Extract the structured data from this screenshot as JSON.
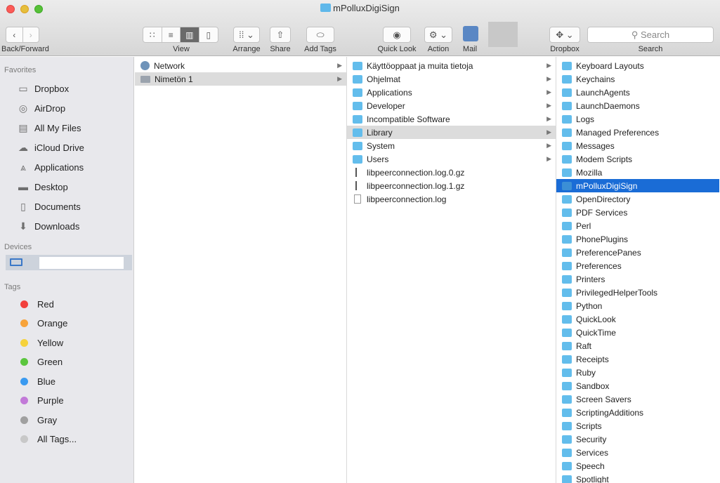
{
  "window": {
    "title": "mPolluxDigiSign"
  },
  "toolbar": {
    "back_forward_label": "Back/Forward",
    "view_label": "View",
    "arrange_label": "Arrange",
    "share_label": "Share",
    "add_tags_label": "Add Tags",
    "quick_look_label": "Quick Look",
    "action_label": "Action",
    "mail_label": "Mail",
    "dropbox_label": "Dropbox",
    "search_label": "Search",
    "search_placeholder": "Search"
  },
  "sidebar": {
    "favorites_header": "Favorites",
    "favorites": [
      {
        "label": "Dropbox",
        "icon": "folder-icon"
      },
      {
        "label": "AirDrop",
        "icon": "airdrop-icon"
      },
      {
        "label": "All My Files",
        "icon": "all-files-icon"
      },
      {
        "label": "iCloud Drive",
        "icon": "cloud-icon"
      },
      {
        "label": "Applications",
        "icon": "applications-icon"
      },
      {
        "label": "Desktop",
        "icon": "desktop-icon"
      },
      {
        "label": "Documents",
        "icon": "documents-icon"
      },
      {
        "label": "Downloads",
        "icon": "downloads-icon"
      }
    ],
    "devices_header": "Devices",
    "tags_header": "Tags",
    "tags": [
      {
        "label": "Red",
        "color": "#f2403c"
      },
      {
        "label": "Orange",
        "color": "#f7a33a"
      },
      {
        "label": "Yellow",
        "color": "#f6d23c"
      },
      {
        "label": "Green",
        "color": "#5bc63e"
      },
      {
        "label": "Blue",
        "color": "#3a9af0"
      },
      {
        "label": "Purple",
        "color": "#c27ad8"
      },
      {
        "label": "Gray",
        "color": "#a0a0a0"
      },
      {
        "label": "All Tags...",
        "color": "#c8c8c8"
      }
    ]
  },
  "columns": {
    "col1": [
      {
        "label": "Network",
        "icon": "globe",
        "arrow": true,
        "state": ""
      },
      {
        "label": "Nimetön 1",
        "icon": "disk",
        "arrow": true,
        "state": "sel-gray"
      }
    ],
    "col2": [
      {
        "label": "Käyttöoppaat ja muita tietoja",
        "icon": "folder",
        "arrow": true,
        "state": ""
      },
      {
        "label": "Ohjelmat",
        "icon": "folder",
        "arrow": true,
        "state": ""
      },
      {
        "label": "Applications",
        "icon": "folder",
        "arrow": true,
        "state": ""
      },
      {
        "label": "Developer",
        "icon": "folder",
        "arrow": true,
        "state": ""
      },
      {
        "label": "Incompatible Software",
        "icon": "folder",
        "arrow": true,
        "state": ""
      },
      {
        "label": "Library",
        "icon": "folder",
        "arrow": true,
        "state": "sel-gray"
      },
      {
        "label": "System",
        "icon": "folder",
        "arrow": true,
        "state": ""
      },
      {
        "label": "Users",
        "icon": "folder",
        "arrow": true,
        "state": ""
      },
      {
        "label": "libpeerconnection.log.0.gz",
        "icon": "gz",
        "arrow": false,
        "state": ""
      },
      {
        "label": "libpeerconnection.log.1.gz",
        "icon": "gz",
        "arrow": false,
        "state": ""
      },
      {
        "label": "libpeerconnection.log",
        "icon": "doc",
        "arrow": false,
        "state": ""
      }
    ],
    "col3": [
      {
        "label": "Keyboard Layouts",
        "icon": "folder",
        "arrow": false,
        "state": ""
      },
      {
        "label": "Keychains",
        "icon": "folder",
        "arrow": false,
        "state": ""
      },
      {
        "label": "LaunchAgents",
        "icon": "folder",
        "arrow": false,
        "state": ""
      },
      {
        "label": "LaunchDaemons",
        "icon": "folder",
        "arrow": false,
        "state": ""
      },
      {
        "label": "Logs",
        "icon": "folder",
        "arrow": false,
        "state": ""
      },
      {
        "label": "Managed Preferences",
        "icon": "folder",
        "arrow": false,
        "state": ""
      },
      {
        "label": "Messages",
        "icon": "folder",
        "arrow": false,
        "state": ""
      },
      {
        "label": "Modem Scripts",
        "icon": "folder",
        "arrow": false,
        "state": ""
      },
      {
        "label": "Mozilla",
        "icon": "folder",
        "arrow": false,
        "state": ""
      },
      {
        "label": "mPolluxDigiSign",
        "icon": "folder",
        "arrow": false,
        "state": "sel-blue"
      },
      {
        "label": "OpenDirectory",
        "icon": "folder",
        "arrow": false,
        "state": ""
      },
      {
        "label": "PDF Services",
        "icon": "folder",
        "arrow": false,
        "state": ""
      },
      {
        "label": "Perl",
        "icon": "folder",
        "arrow": false,
        "state": ""
      },
      {
        "label": "PhonePlugins",
        "icon": "folder",
        "arrow": false,
        "state": ""
      },
      {
        "label": "PreferencePanes",
        "icon": "folder",
        "arrow": false,
        "state": ""
      },
      {
        "label": "Preferences",
        "icon": "folder",
        "arrow": false,
        "state": ""
      },
      {
        "label": "Printers",
        "icon": "folder",
        "arrow": false,
        "state": ""
      },
      {
        "label": "PrivilegedHelperTools",
        "icon": "folder",
        "arrow": false,
        "state": ""
      },
      {
        "label": "Python",
        "icon": "folder",
        "arrow": false,
        "state": ""
      },
      {
        "label": "QuickLook",
        "icon": "folder",
        "arrow": false,
        "state": ""
      },
      {
        "label": "QuickTime",
        "icon": "folder",
        "arrow": false,
        "state": ""
      },
      {
        "label": "Raft",
        "icon": "folder",
        "arrow": false,
        "state": ""
      },
      {
        "label": "Receipts",
        "icon": "folder",
        "arrow": false,
        "state": ""
      },
      {
        "label": "Ruby",
        "icon": "folder",
        "arrow": false,
        "state": ""
      },
      {
        "label": "Sandbox",
        "icon": "folder",
        "arrow": false,
        "state": ""
      },
      {
        "label": "Screen Savers",
        "icon": "folder",
        "arrow": false,
        "state": ""
      },
      {
        "label": "ScriptingAdditions",
        "icon": "folder",
        "arrow": false,
        "state": ""
      },
      {
        "label": "Scripts",
        "icon": "folder",
        "arrow": false,
        "state": ""
      },
      {
        "label": "Security",
        "icon": "folder",
        "arrow": false,
        "state": ""
      },
      {
        "label": "Services",
        "icon": "folder",
        "arrow": false,
        "state": ""
      },
      {
        "label": "Speech",
        "icon": "folder",
        "arrow": false,
        "state": ""
      },
      {
        "label": "Spotlight",
        "icon": "folder",
        "arrow": false,
        "state": ""
      }
    ]
  },
  "colors": {
    "selection_blue": "#1a6cd6",
    "selection_gray": "#dcdcdc",
    "folder_blue": "#63bdec"
  }
}
